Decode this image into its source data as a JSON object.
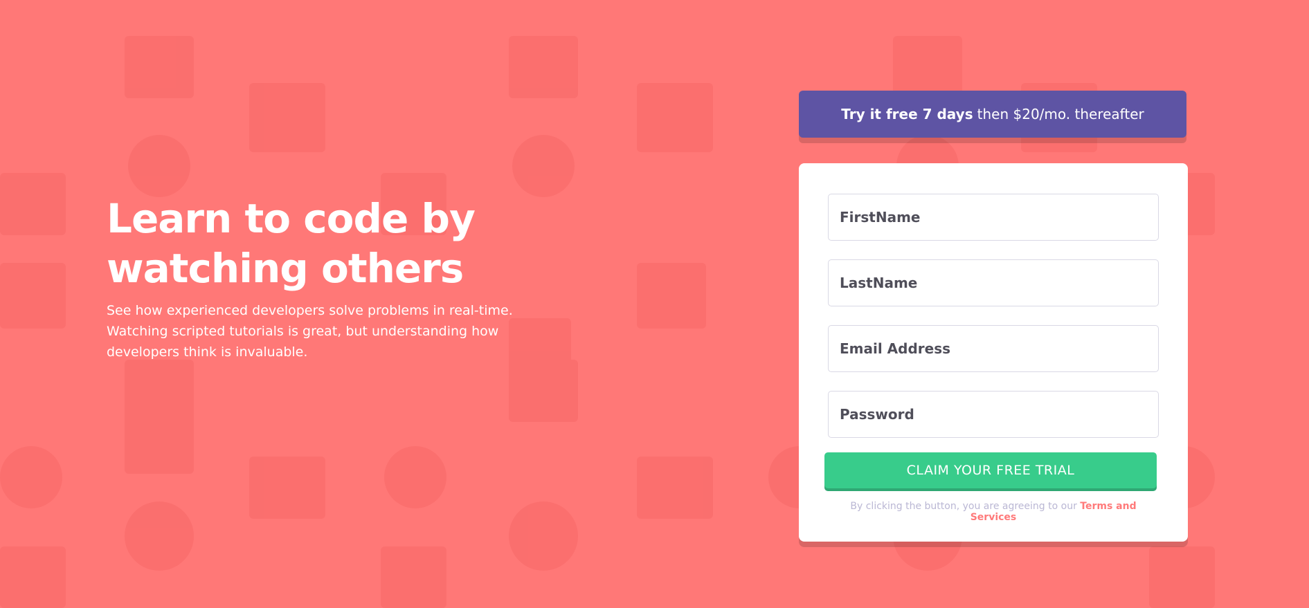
{
  "colors": {
    "background": "#ff7877",
    "banner": "#5e54a4",
    "button": "#38cc8b",
    "link": "#ff7a7a"
  },
  "hero": {
    "title": "Learn to code by watching others",
    "description": "See how experienced developers solve problems in real-time. Watching scripted tutorials is great, but understanding how developers think is invaluable."
  },
  "banner": {
    "strong_text": "Try it free 7 days",
    "rest_text": "then $20/mo. thereafter"
  },
  "form": {
    "first_name_placeholder": "FirstName",
    "last_name_placeholder": "LastName",
    "email_placeholder": "Email Address",
    "password_placeholder": "Password",
    "submit_label": "CLAIM YOUR FREE TRIAL",
    "terms_prefix": "By clicking the button, you are agreeing to our",
    "terms_link": "Terms and Services"
  }
}
